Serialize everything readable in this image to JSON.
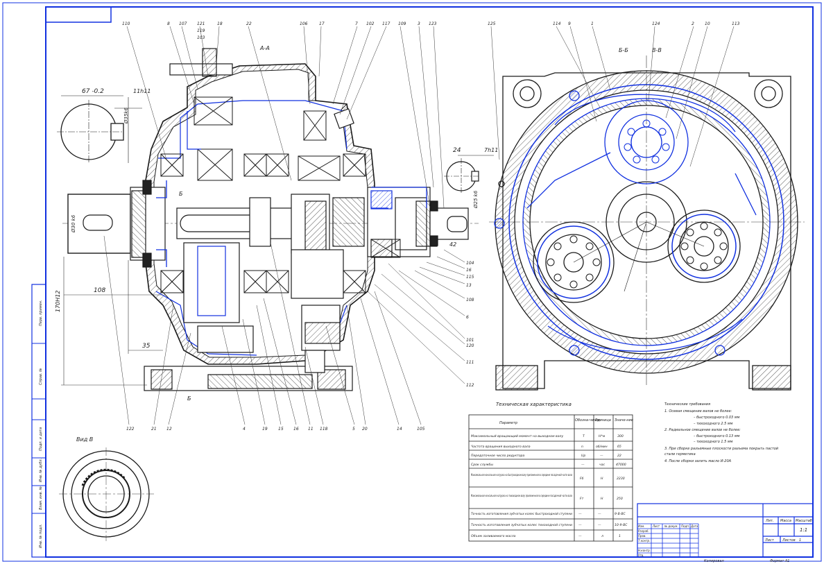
{
  "drawing": {
    "section_top_label": "А-А",
    "section_left_label": "Б",
    "section_bottom_label": "Б",
    "section_b_label": "Б-Б",
    "section_b2_label": "В-В",
    "view_label": "Вид В",
    "leader_numbers_top": [
      "110",
      "8",
      "107",
      "121",
      "119",
      "103",
      "18",
      "22",
      "106",
      "17",
      "7",
      "102",
      "117",
      "109",
      "3",
      "123",
      "125",
      "114",
      "9",
      "1",
      "124",
      "2",
      "10",
      "113"
    ],
    "leader_numbers_bottom": [
      "122",
      "21",
      "12",
      "4",
      "19",
      "15",
      "16",
      "11",
      "118",
      "5",
      "20",
      "14",
      "105"
    ],
    "leader_numbers_right": [
      "104",
      "16",
      "115",
      "13",
      "108",
      "6",
      "101",
      "120",
      "111",
      "112"
    ],
    "dims": {
      "d67": "67 -0.2",
      "d11h11": "11h11",
      "d108": "108",
      "d35": "35",
      "d24": "24",
      "d7h11": "7h11",
      "d42": "42",
      "d_out_left": "Ø30 k6",
      "d_out_right": "Ø25 k6",
      "d_shaft": "Ø35k6",
      "d_height": "170Н12"
    }
  },
  "tech_char": {
    "title": "Техническая характеристика",
    "headers": [
      "Параметр",
      "Обозна-чение",
      "Единица",
      "Значе-ние"
    ],
    "rows": [
      [
        "Максимальный вращающий момент на выходном валу",
        "T",
        "Н*м",
        "300"
      ],
      [
        "Частота вращения выходного вала",
        "n",
        "об/мин",
        "65"
      ],
      [
        "Передаточное число редуктора",
        "Uр",
        "—",
        "22"
      ],
      [
        "Срок службы",
        "—",
        "час",
        "47000"
      ],
      [
        "Максимальная консольная нагрузка на быстроходном валу приложенная в середине посадочной части вала",
        "Fб",
        "Н",
        "2230"
      ],
      [
        "Максимальная консольная нагрузка на тихоходном валу приложенная в середине посадочной части вала",
        "Fт",
        "Н",
        "250"
      ],
      [
        "Точность изготовления зубчатых колес быстроходной ступени",
        "—",
        "—",
        "9-В-ВС"
      ],
      [
        "Точность изготовления зубчатых колес тихоходной ступени",
        "—",
        "—",
        "10-9-ВС"
      ],
      [
        "Объем заливаемого масла",
        "—",
        "л",
        "1"
      ]
    ]
  },
  "tech_req": {
    "title": "Технические требования",
    "lines": [
      "1. Осевая смещение валов не более:",
      "– быстроходного   0.03 мм",
      "– тихоходного       2.5 мм",
      "2. Радиальное смещение валов не более:",
      "– быстроходного   0.13 мм",
      "– тихоходного       1.5 мм",
      "3. При сборке разъемные плоскости разъема покрыть пастой",
      "   стали герметика",
      "4. После сборки залить масло И-20А"
    ]
  },
  "title_block": {
    "cols": [
      "Лит.",
      "Масса",
      "Масштаб"
    ],
    "scale": "1:1",
    "sheet_label": "Лист",
    "sheets_label": "Листов",
    "sheets_value": "1",
    "rows": [
      "Изм.",
      "Лист",
      "№ докум.",
      "Подп.",
      "Дата"
    ],
    "roles": [
      "Разраб.",
      "Пров.",
      "Т.контр.",
      "Н.контр.",
      "Утв."
    ],
    "copied": "Копировал",
    "format": "Формат  A1"
  },
  "side_strip": [
    "Перв. примен.",
    "Справ. №",
    "Подп. и дата",
    "Инв. № дубл.",
    "Взам. инв. №",
    "Подп. и дата",
    "Инв. № подл."
  ],
  "colors": {
    "line": "#1a1a1a",
    "hidden": "#0b2fd6",
    "frame": "#1030e0"
  }
}
